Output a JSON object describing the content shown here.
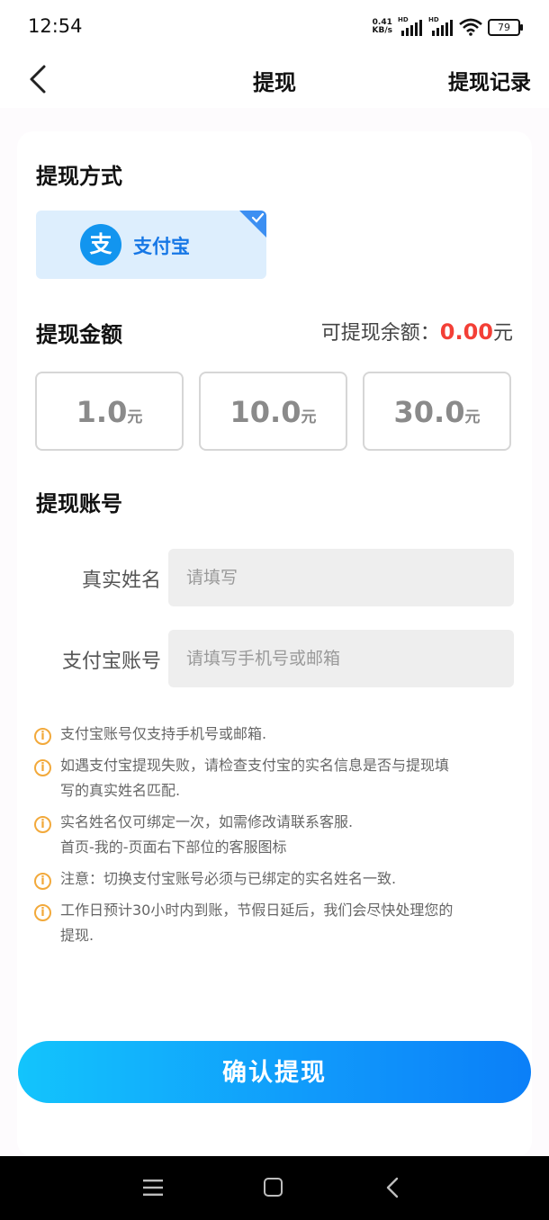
{
  "status": {
    "time": "12:54",
    "net_speed_value": "0.41",
    "net_speed_unit": "KB/s",
    "signal_label": "HD",
    "battery": "79"
  },
  "nav": {
    "title": "提现",
    "record": "提现记录"
  },
  "method": {
    "section_title": "提现方式",
    "selected": "支付宝",
    "logo_glyph": "支"
  },
  "amount": {
    "section_title": "提现金额",
    "balance_label": "可提现余额：",
    "balance_value": "0.00",
    "balance_unit": "元",
    "options": [
      {
        "value": "1.0",
        "unit": "元"
      },
      {
        "value": "10.0",
        "unit": "元"
      },
      {
        "value": "30.0",
        "unit": "元"
      }
    ]
  },
  "account": {
    "section_title": "提现账号",
    "name_label": "真实姓名",
    "name_placeholder": "请填写",
    "alipay_label": "支付宝账号",
    "alipay_placeholder": "请填写手机号或邮箱"
  },
  "notes": [
    "支付宝账号仅支持手机号或邮箱.",
    "如遇支付宝提现失败，请检查支付宝的实名信息是否与提现填\n写的真实姓名匹配.",
    "实名姓名仅可绑定一次，如需修改请联系客服.\n首页-我的-页面右下部位的客服图标",
    "注意：切换支付宝账号必须与已绑定的实名姓名一致.",
    "工作日预计30小时内到账，节假日延后，我们会尽快处理您的\n提现."
  ],
  "note_icon": "i",
  "confirm": {
    "label": "确认提现"
  },
  "colors": {
    "accent": "#1295ef",
    "balance": "#f33f36",
    "warning": "#f2a93b"
  }
}
